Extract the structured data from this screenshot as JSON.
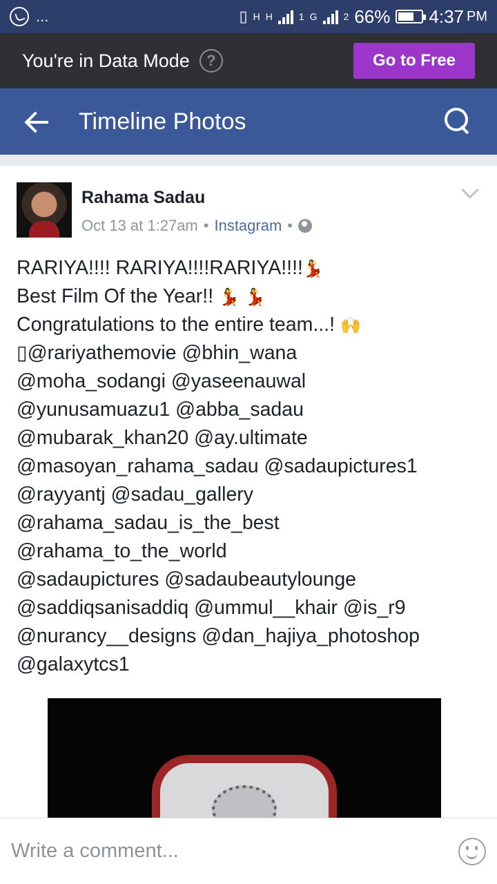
{
  "status_bar": {
    "left_dots": "...",
    "network_h1": "H",
    "network_h2": "H",
    "network_g": "G",
    "sim1": "1",
    "sim2": "2",
    "battery": "66%",
    "time": "4:37",
    "ampm": "PM"
  },
  "data_mode": {
    "text": "You're in Data Mode",
    "help": "?",
    "button": "Go to Free"
  },
  "appbar": {
    "title": "Timeline Photos"
  },
  "post": {
    "author": "Rahama Sadau",
    "date": "Oct 13 at 1:27am",
    "separator": "•",
    "source": "Instagram",
    "lines": [
      "RARIYA!!!! RARIYA!!!!RARIYA!!!!",
      "Best Film Of the Year!!",
      "Congratulations to the entire team...!",
      "@rariyathemovie @bhin_wana",
      "@moha_sodangi @yaseenauwal",
      "@yunusamuazu1 @abba_sadau",
      "@mubarak_khan20 @ay.ultimate",
      "@masoyan_rahama_sadau @sadaupictures1",
      "@rayyantj @sadau_gallery",
      "@rahama_sadau_is_the_best",
      "@rahama_to_the_world",
      "@sadaupictures @sadaubeautylounge",
      "@saddiqsanisaddiq @ummul__khair @is_r9",
      "@nurancy__designs @dan_hajiya_photoshop",
      "@galaxytcs1"
    ],
    "emojis": {
      "dancer": "💃",
      "pray": "🙌",
      "missing": "▯"
    }
  },
  "comment": {
    "placeholder": "Write a comment..."
  }
}
